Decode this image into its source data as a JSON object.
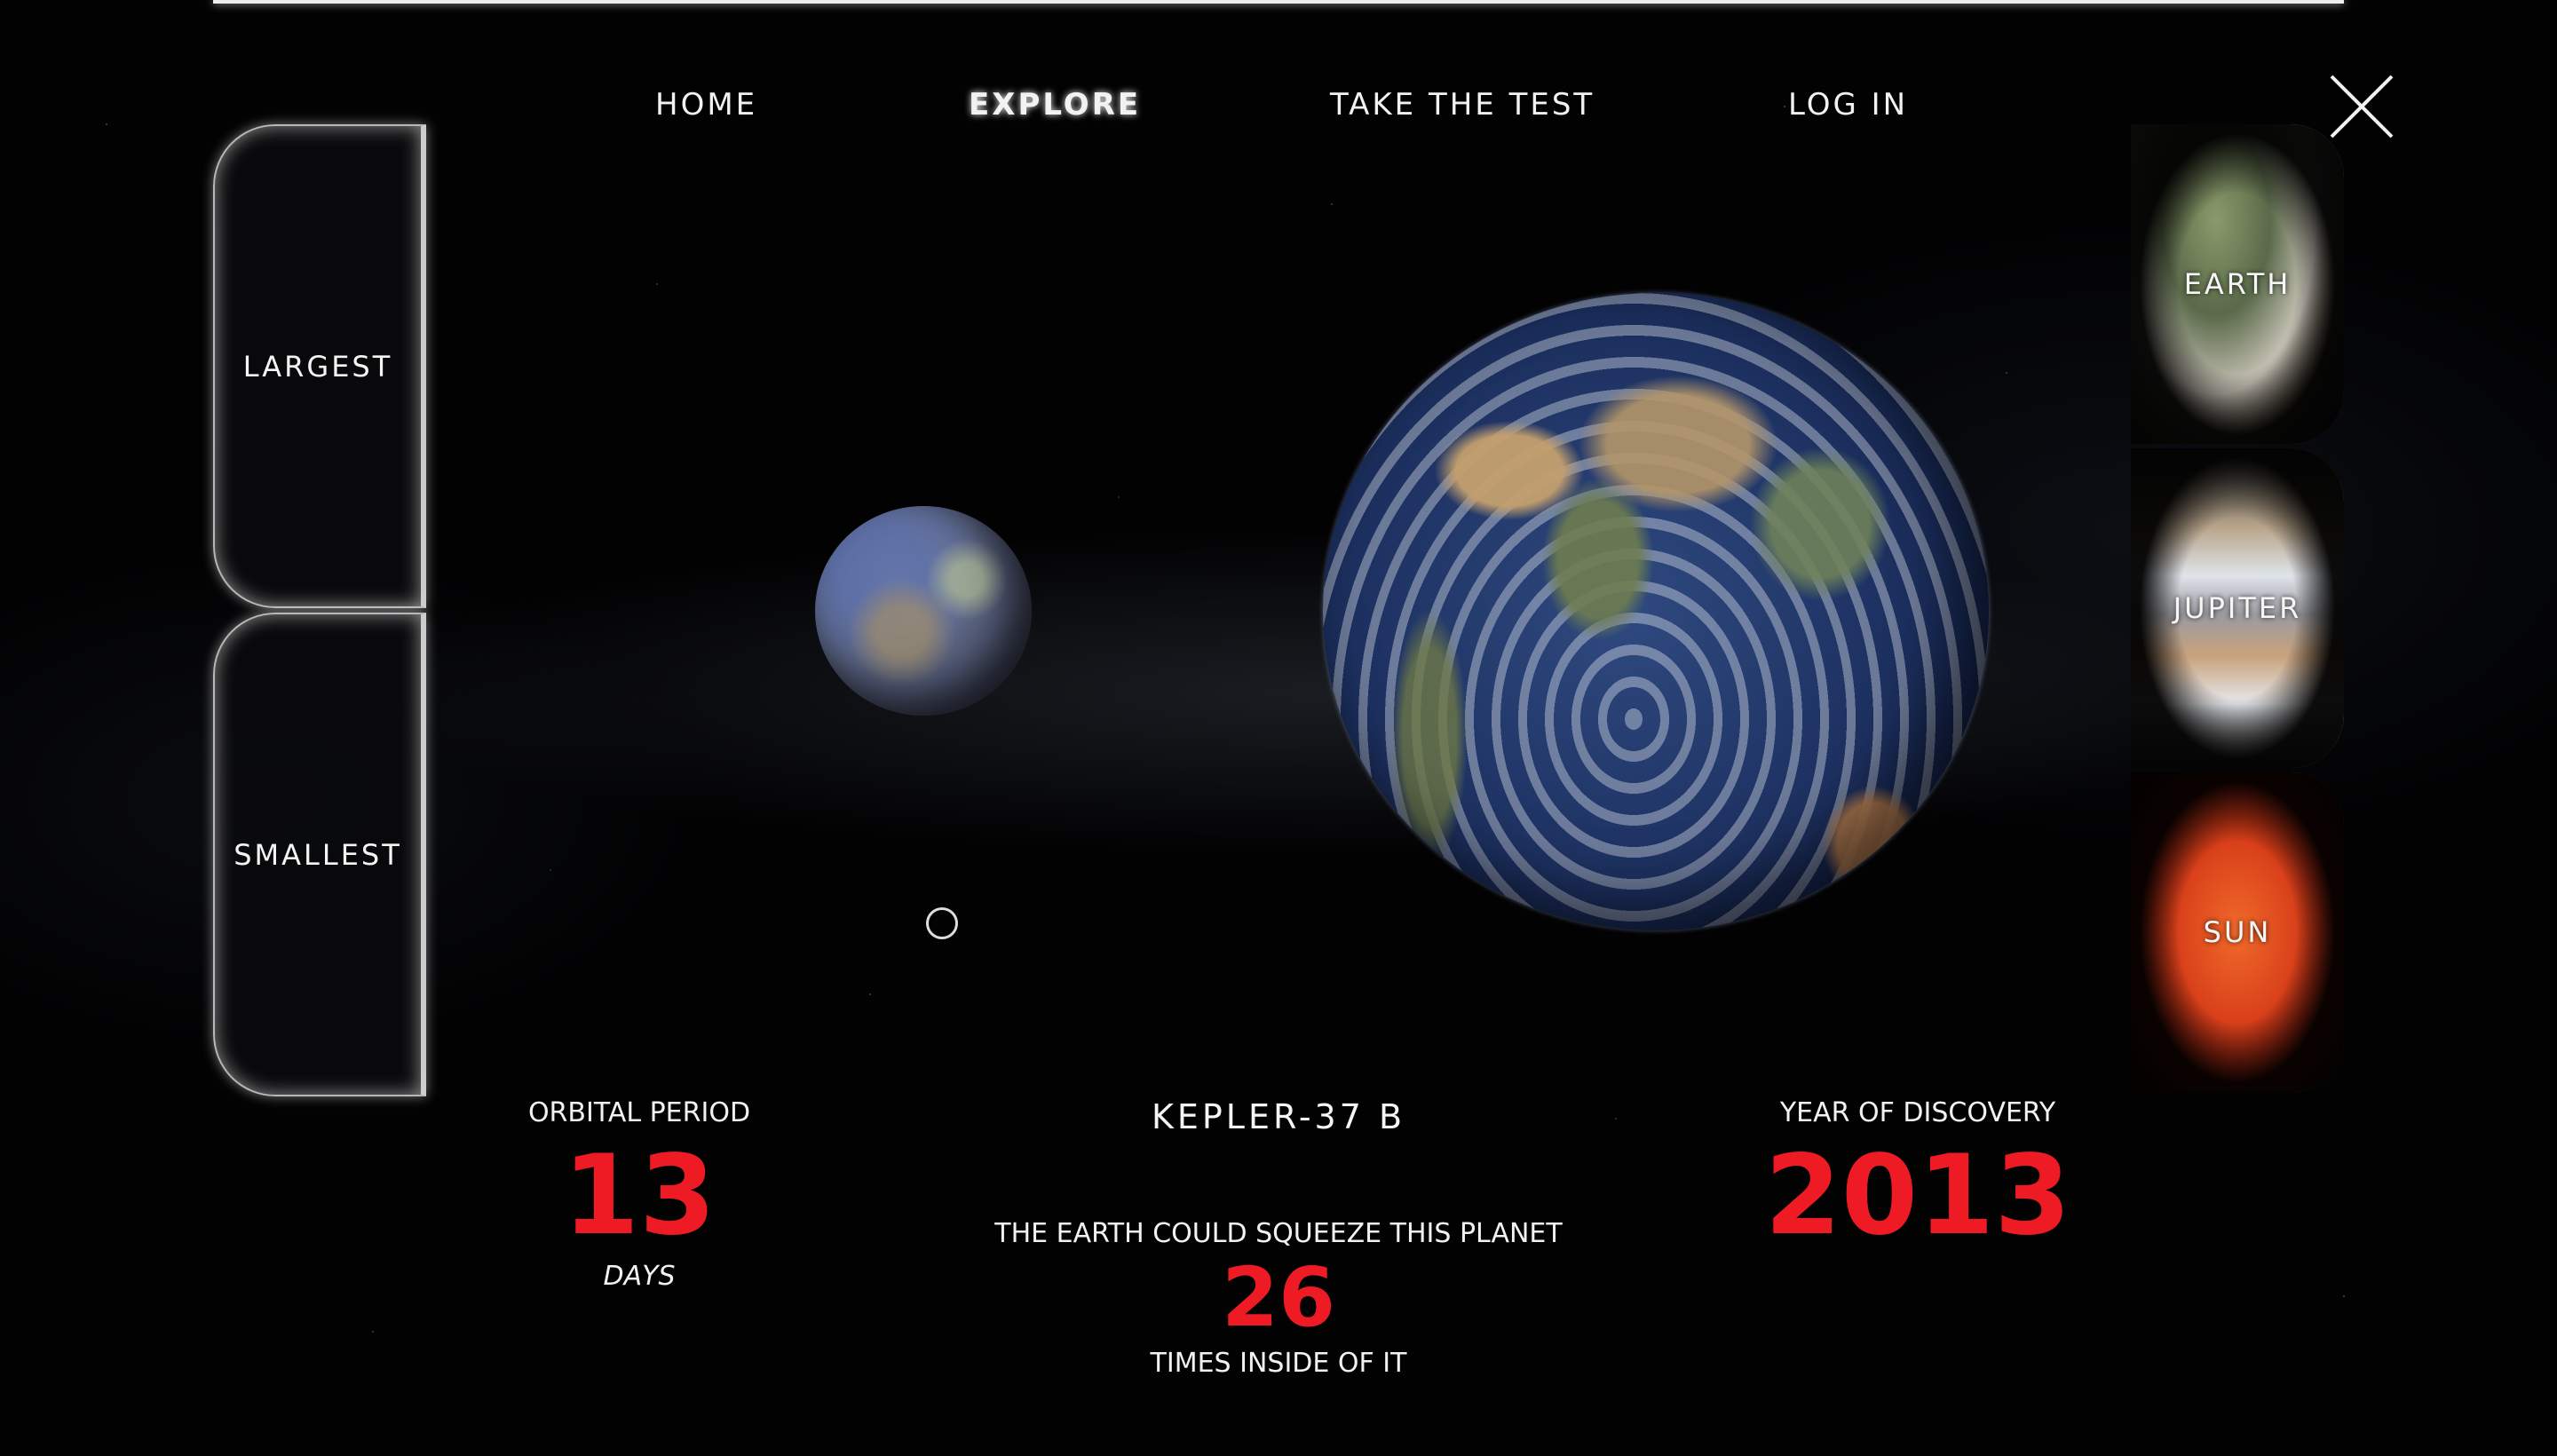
{
  "nav": {
    "items": [
      {
        "label": "HOME",
        "active": false
      },
      {
        "label": "EXPLORE",
        "active": true
      },
      {
        "label": "TAKE THE TEST",
        "active": false
      },
      {
        "label": "LOG IN",
        "active": false
      }
    ]
  },
  "close_icon": "close-x-icon",
  "filters": {
    "largest_label": "LARGEST",
    "smallest_label": "SMALLEST"
  },
  "comparison_planets": [
    {
      "label": "EARTH",
      "color": "#6d7a5c"
    },
    {
      "label": "JUPITER",
      "color": "#b8a48c"
    },
    {
      "label": "SUN",
      "color": "#e0451c"
    }
  ],
  "planet": {
    "name": "KEPLER-37 B",
    "orbital_period": {
      "label": "ORBITAL PERIOD",
      "value": "13",
      "unit": "DAYS"
    },
    "size_comparison": {
      "prefix": "THE EARTH COULD SQUEEZE THIS PLANET",
      "value": "26",
      "suffix": "TIMES INSIDE OF IT"
    },
    "discovery": {
      "label": "YEAR OF DISCOVERY",
      "value": "2013"
    }
  },
  "colors": {
    "accent_red": "#ef1b24",
    "text": "#f2f2f2",
    "background": "#020203"
  }
}
